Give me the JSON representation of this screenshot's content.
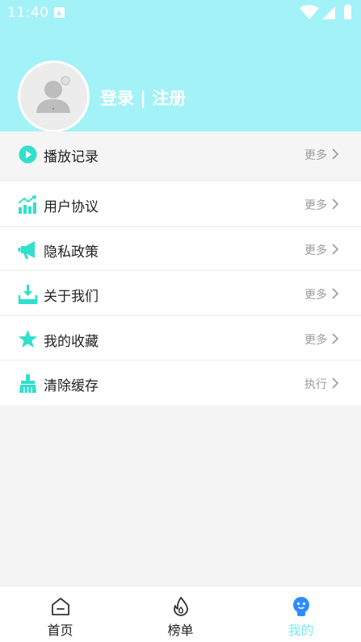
{
  "status_bar": {
    "time": "11:40"
  },
  "header": {
    "login_register": "登录 | 注册"
  },
  "menu_top": [
    {
      "icon": "play-icon",
      "label": "播放记录",
      "action": "更多"
    }
  ],
  "menu_main": [
    {
      "icon": "chart-icon",
      "label": "用户协议",
      "action": "更多"
    },
    {
      "icon": "megaphone-icon",
      "label": "隐私政策",
      "action": "更多"
    },
    {
      "icon": "download-icon",
      "label": "关于我们",
      "action": "更多"
    },
    {
      "icon": "star-icon",
      "label": "我的收藏",
      "action": "更多"
    },
    {
      "icon": "broom-icon",
      "label": "清除缓存",
      "action": "执行"
    }
  ],
  "tabbar": {
    "items": [
      {
        "icon": "home-icon",
        "label": "首页"
      },
      {
        "icon": "fire-icon",
        "label": "榜单"
      },
      {
        "icon": "profile-icon",
        "label": "我的"
      }
    ],
    "active_index": 2
  },
  "colors": {
    "header_bg": "#a2f2f8",
    "accent": "#2fe0cc",
    "active_tab": "#7ee9f4",
    "profile_icon": "#2f8cff"
  }
}
